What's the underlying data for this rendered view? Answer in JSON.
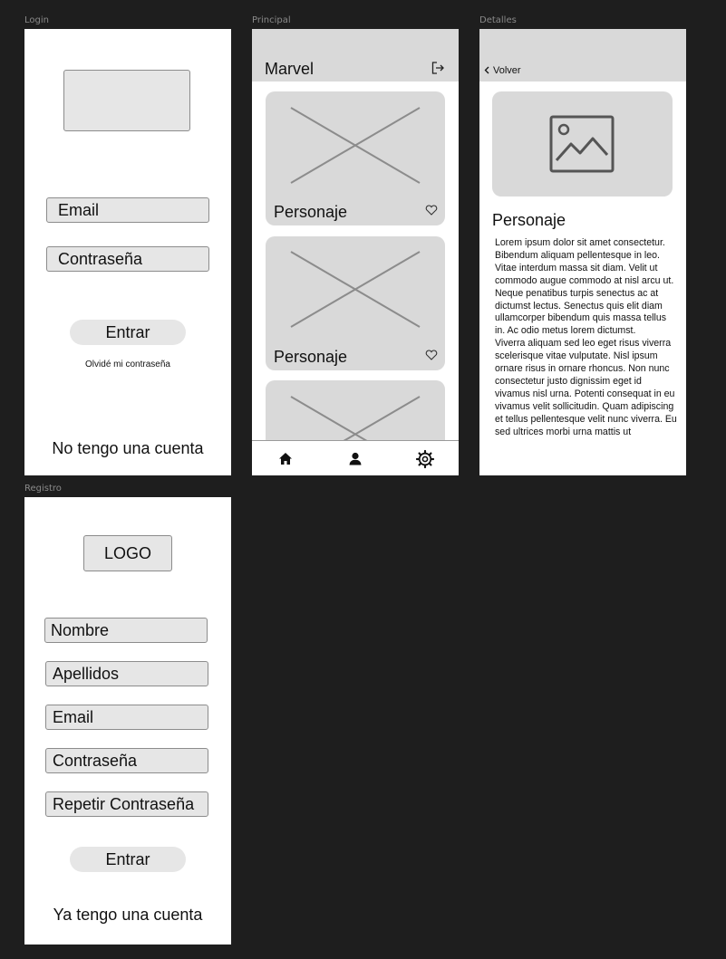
{
  "frames": {
    "login": "Login",
    "principal": "Principal",
    "detalles": "Detalles",
    "registro": "Registro"
  },
  "login": {
    "email_placeholder": "Email",
    "password_placeholder": "Contraseña",
    "submit_label": "Entrar",
    "forgot_link": "Olvidé mi contraseña",
    "no_account_link": "No tengo una cuenta"
  },
  "principal": {
    "title": "Marvel",
    "cards": [
      {
        "title": "Personaje"
      },
      {
        "title": "Personaje"
      }
    ],
    "tabs": [
      "home-icon",
      "user-icon",
      "settings-icon"
    ]
  },
  "detalles": {
    "back_label": "Volver",
    "title": "Personaje",
    "body": "Lorem ipsum dolor sit amet consectetur. Bibendum aliquam pellentesque in leo. Vitae interdum massa sit diam. Velit ut commodo augue commodo at nisl arcu ut. Neque penatibus turpis senectus ac at dictumst lectus. Senectus quis elit diam ullamcorper bibendum quis massa tellus in. Ac odio metus lorem dictumst.\nViverra aliquam sed leo eget risus viverra scelerisque vitae vulputate. Nisl ipsum ornare risus in ornare rhoncus. Non nunc consectetur justo dignissim eget id vivamus nisl urna. Potenti consequat in eu vivamus velit sollicitudin. Quam adipiscing et tellus pellentesque velit nunc viverra. Eu sed ultrices morbi urna mattis ut"
  },
  "registro": {
    "logo": "LOGO",
    "name_placeholder": "Nombre",
    "surname_placeholder": "Apellidos",
    "email_placeholder": "Email",
    "password_placeholder": "Contraseña",
    "repeat_password_placeholder": "Repetir Contraseña",
    "submit_label": "Entrar",
    "have_account_link": "Ya tengo una cuenta"
  },
  "colors": {
    "canvas": "#1e1e1e",
    "frame": "#ffffff",
    "placeholder_fill": "#d9d9d9",
    "input_fill": "#e6e6e6",
    "stroke": "#8c8c8c"
  }
}
